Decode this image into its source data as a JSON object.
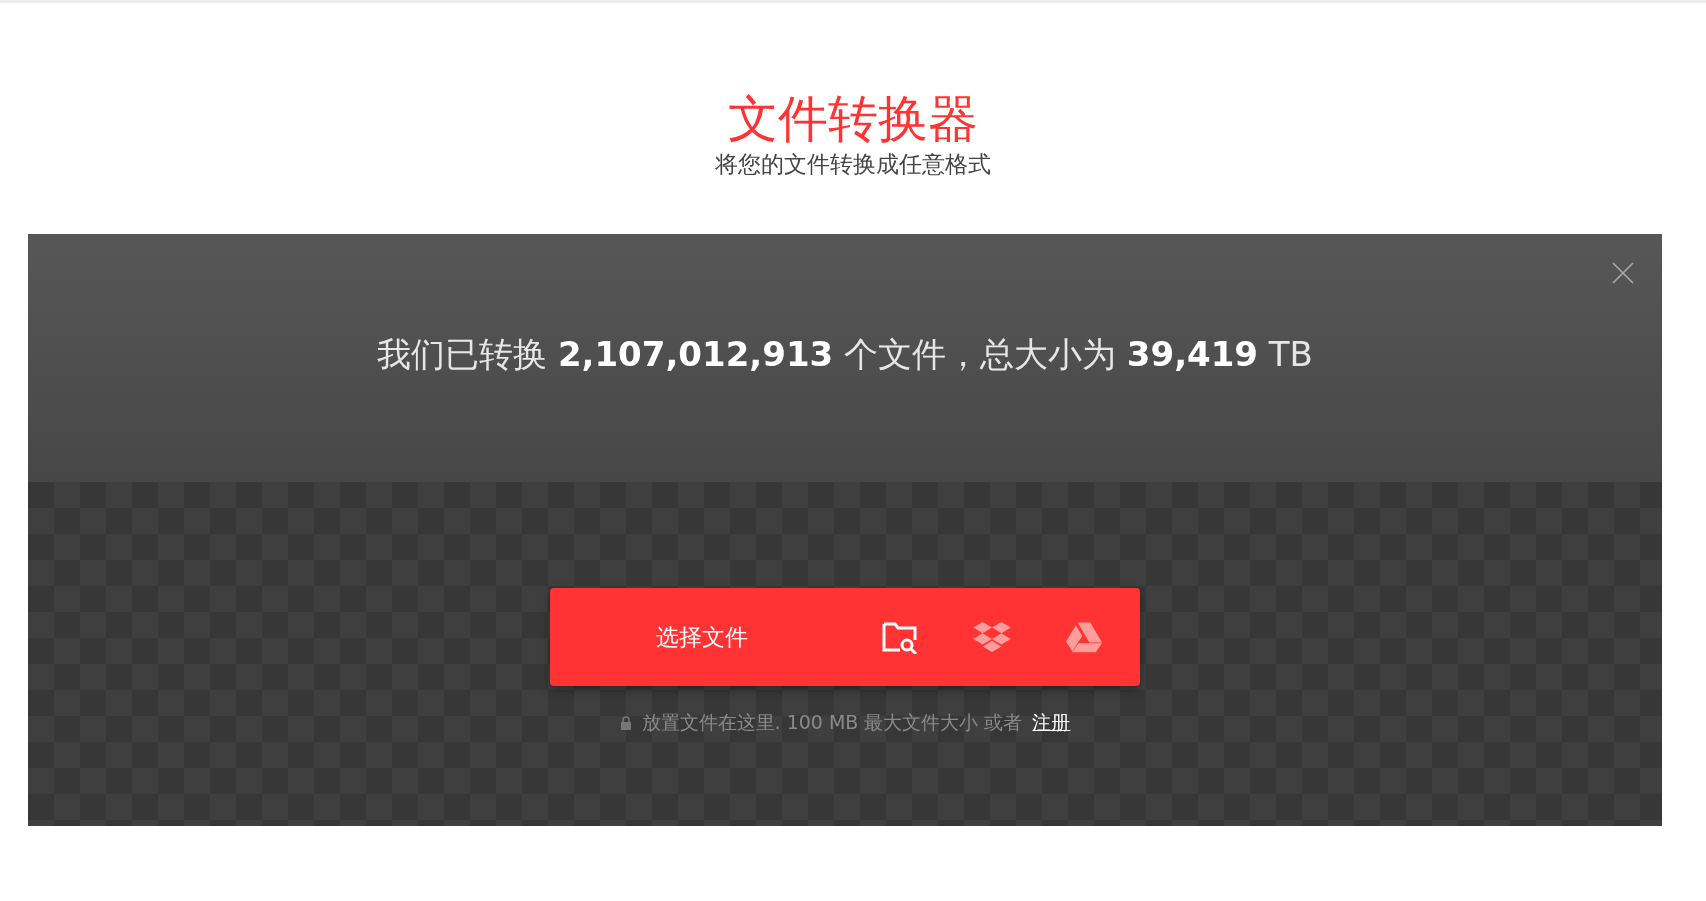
{
  "header": {
    "title": "文件转换器",
    "subtitle": "将您的文件转换成任意格式"
  },
  "banner": {
    "stats": "我们已转换 **2,107,012,913** 个文件，总大小为 **39,419** TB"
  },
  "upload": {
    "button": "选择文件",
    "note": "放置文件在这里. 100 MB 最大文件大小 或者",
    "link": "注册"
  }
}
